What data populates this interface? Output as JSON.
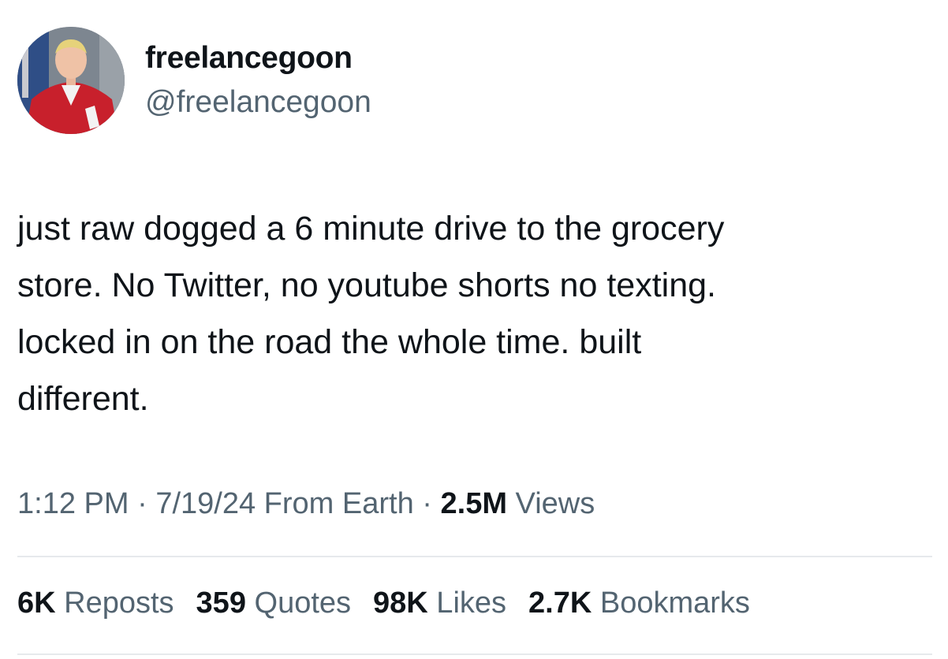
{
  "user": {
    "display_name": "freelancegoon",
    "handle": "@freelancegoon"
  },
  "tweet": {
    "lines": [
      "just raw dogged a 6 minute drive to the grocery",
      "store. No Twitter, no youtube shorts no texting.",
      "locked in on the road the whole time. built",
      "different."
    ]
  },
  "meta": {
    "time": "1:12 PM",
    "sep1": " · ",
    "date": "7/19/24",
    "source": " From Earth",
    "sep2": " · ",
    "views_count": "2.5M",
    "views_label": " Views"
  },
  "stats": {
    "reposts_count": "6K",
    "reposts_label": " Reposts",
    "quotes_count": "359",
    "quotes_label": " Quotes",
    "likes_count": "98K",
    "likes_label": " Likes",
    "bookmarks_count": "2.7K",
    "bookmarks_label": " Bookmarks"
  },
  "colors": {
    "text_primary": "#0f1419",
    "text_secondary": "#536471",
    "divider": "#e6e9ec"
  }
}
